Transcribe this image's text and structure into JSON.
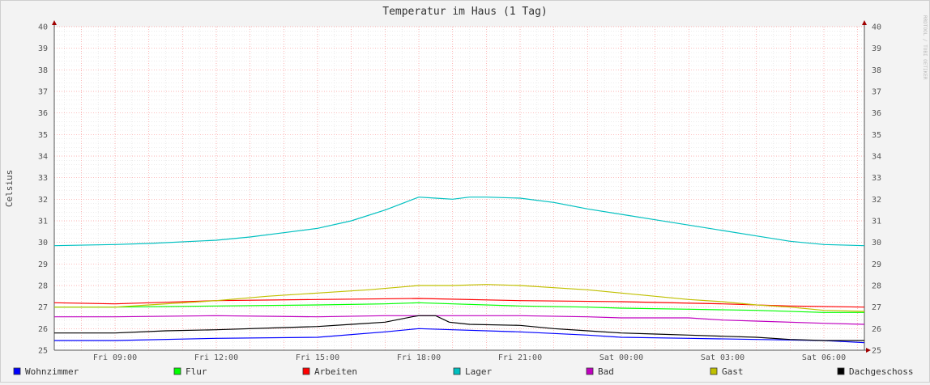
{
  "chart_data": {
    "type": "line",
    "title": "Temperatur im Haus (1 Tag)",
    "ylabel": "Celsius",
    "xlabel": "",
    "watermark": "RRDTOOL / TOBI OETIKER",
    "ylim": [
      25,
      40
    ],
    "yticks": [
      25,
      26,
      27,
      28,
      29,
      30,
      31,
      32,
      33,
      34,
      35,
      36,
      37,
      38,
      39,
      40
    ],
    "xlim_hours": [
      7.2,
      31.2
    ],
    "xticks": [
      {
        "hour": 9,
        "label": "Fri 09:00"
      },
      {
        "hour": 12,
        "label": "Fri 12:00"
      },
      {
        "hour": 15,
        "label": "Fri 15:00"
      },
      {
        "hour": 18,
        "label": "Fri 18:00"
      },
      {
        "hour": 21,
        "label": "Fri 21:00"
      },
      {
        "hour": 24,
        "label": "Sat 00:00"
      },
      {
        "hour": 27,
        "label": "Sat 03:00"
      },
      {
        "hour": 30,
        "label": "Sat 06:00"
      }
    ],
    "grid": true,
    "legend_position": "bottom",
    "series": [
      {
        "name": "Wohnzimmer",
        "color": "#0000ff",
        "points": [
          [
            7.2,
            25.45
          ],
          [
            9,
            25.45
          ],
          [
            12,
            25.55
          ],
          [
            15,
            25.6
          ],
          [
            17,
            25.85
          ],
          [
            18,
            26.0
          ],
          [
            19,
            25.95
          ],
          [
            21,
            25.85
          ],
          [
            23,
            25.7
          ],
          [
            24,
            25.6
          ],
          [
            26,
            25.55
          ],
          [
            28,
            25.5
          ],
          [
            30,
            25.45
          ],
          [
            31.2,
            25.35
          ]
        ]
      },
      {
        "name": "Flur",
        "color": "#00ff00",
        "points": [
          [
            7.2,
            27.0
          ],
          [
            9,
            27.0
          ],
          [
            12,
            27.05
          ],
          [
            15,
            27.1
          ],
          [
            17,
            27.15
          ],
          [
            18,
            27.2
          ],
          [
            19,
            27.15
          ],
          [
            21,
            27.05
          ],
          [
            23,
            27.0
          ],
          [
            24,
            26.95
          ],
          [
            26,
            26.9
          ],
          [
            28,
            26.85
          ],
          [
            30,
            26.75
          ],
          [
            31.2,
            26.75
          ]
        ]
      },
      {
        "name": "Arbeiten",
        "color": "#ff0000",
        "points": [
          [
            7.2,
            27.2
          ],
          [
            9,
            27.15
          ],
          [
            12,
            27.3
          ],
          [
            15,
            27.35
          ],
          [
            18,
            27.4
          ],
          [
            21,
            27.3
          ],
          [
            24,
            27.25
          ],
          [
            27,
            27.15
          ],
          [
            29,
            27.05
          ],
          [
            31.2,
            27.0
          ]
        ]
      },
      {
        "name": "Lager",
        "color": "#00c0c0",
        "points": [
          [
            7.2,
            29.85
          ],
          [
            9,
            29.9
          ],
          [
            10,
            29.95
          ],
          [
            12,
            30.1
          ],
          [
            13,
            30.25
          ],
          [
            14,
            30.45
          ],
          [
            15,
            30.65
          ],
          [
            16,
            31.0
          ],
          [
            17,
            31.5
          ],
          [
            17.5,
            31.8
          ],
          [
            18,
            32.1
          ],
          [
            18.5,
            32.05
          ],
          [
            19,
            32.0
          ],
          [
            19.5,
            32.1
          ],
          [
            20,
            32.1
          ],
          [
            21,
            32.05
          ],
          [
            22,
            31.85
          ],
          [
            23,
            31.55
          ],
          [
            24,
            31.3
          ],
          [
            25,
            31.05
          ],
          [
            26,
            30.8
          ],
          [
            27,
            30.55
          ],
          [
            28,
            30.3
          ],
          [
            29,
            30.05
          ],
          [
            30,
            29.9
          ],
          [
            31.2,
            29.85
          ]
        ]
      },
      {
        "name": "Bad",
        "color": "#c000c0",
        "points": [
          [
            7.2,
            26.55
          ],
          [
            9,
            26.55
          ],
          [
            12,
            26.6
          ],
          [
            15,
            26.55
          ],
          [
            17,
            26.6
          ],
          [
            18,
            26.6
          ],
          [
            21,
            26.6
          ],
          [
            23,
            26.55
          ],
          [
            24,
            26.5
          ],
          [
            26,
            26.5
          ],
          [
            27,
            26.4
          ],
          [
            28,
            26.35
          ],
          [
            30,
            26.25
          ],
          [
            31.2,
            26.2
          ]
        ]
      },
      {
        "name": "Gast",
        "color": "#c0c000",
        "points": [
          [
            7.2,
            27.0
          ],
          [
            9,
            27.0
          ],
          [
            10,
            27.1
          ],
          [
            12,
            27.3
          ],
          [
            13.5,
            27.5
          ],
          [
            15,
            27.65
          ],
          [
            16.5,
            27.8
          ],
          [
            18,
            28.0
          ],
          [
            19,
            28.0
          ],
          [
            20,
            28.05
          ],
          [
            21,
            28.0
          ],
          [
            22,
            27.9
          ],
          [
            23,
            27.8
          ],
          [
            24,
            27.65
          ],
          [
            25,
            27.5
          ],
          [
            26,
            27.35
          ],
          [
            27,
            27.25
          ],
          [
            28,
            27.1
          ],
          [
            29,
            27.0
          ],
          [
            30,
            26.85
          ],
          [
            31.2,
            26.8
          ]
        ]
      },
      {
        "name": "Dachgeschoss",
        "color": "#000000",
        "points": [
          [
            7.2,
            25.8
          ],
          [
            9,
            25.8
          ],
          [
            10.5,
            25.9
          ],
          [
            12,
            25.95
          ],
          [
            14,
            26.05
          ],
          [
            15,
            26.1
          ],
          [
            16,
            26.2
          ],
          [
            17,
            26.3
          ],
          [
            17.8,
            26.55
          ],
          [
            18,
            26.6
          ],
          [
            18.5,
            26.6
          ],
          [
            18.9,
            26.3
          ],
          [
            19.5,
            26.2
          ],
          [
            21,
            26.15
          ],
          [
            22,
            26.0
          ],
          [
            23,
            25.9
          ],
          [
            24,
            25.8
          ],
          [
            25,
            25.75
          ],
          [
            26,
            25.7
          ],
          [
            27,
            25.65
          ],
          [
            28,
            25.6
          ],
          [
            29,
            25.5
          ],
          [
            30,
            25.45
          ],
          [
            31.2,
            25.45
          ]
        ]
      }
    ]
  }
}
